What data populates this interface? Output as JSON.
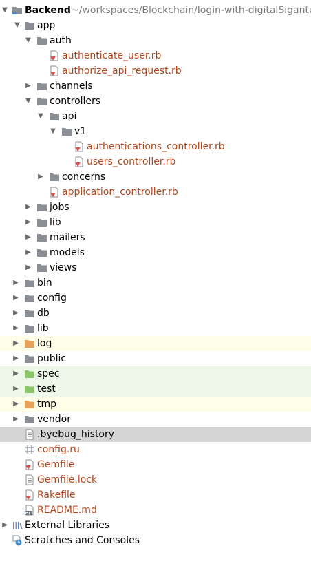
{
  "project": {
    "name": "Backend",
    "path": "~/workspaces/Blockchain/login-with-digitalSiganture"
  },
  "tree": {
    "app": "app",
    "auth": "auth",
    "authenticate_user": "authenticate_user.rb",
    "authorize_api_request": "authorize_api_request.rb",
    "channels": "channels",
    "controllers": "controllers",
    "api": "api",
    "v1": "v1",
    "authentications_controller": "authentications_controller.rb",
    "users_controller": "users_controller.rb",
    "concerns": "concerns",
    "application_controller": "application_controller.rb",
    "jobs": "jobs",
    "app_lib": "lib",
    "mailers": "mailers",
    "models": "models",
    "views": "views",
    "bin": "bin",
    "config": "config",
    "db": "db",
    "lib": "lib",
    "log": "log",
    "public": "public",
    "spec": "spec",
    "test": "test",
    "tmp": "tmp",
    "vendor": "vendor",
    "byebug_history": ".byebug_history",
    "config_ru": "config.ru",
    "gemfile": "Gemfile",
    "gemfile_lock": "Gemfile.lock",
    "rakefile": "Rakefile",
    "readme": "README.md",
    "external_libraries": "External Libraries",
    "scratches": "Scratches and Consoles"
  },
  "colors": {
    "folder": "#8a8f96",
    "folder_excluded": "#e8a25a",
    "folder_test": "#8bc56a",
    "ruby_file_text": "#b0461a",
    "ruby_icon": "#d9534f",
    "excluded_row_bg": "#fdfde8",
    "test_row_bg": "#eef8e8",
    "selected_row_bg": "#d5d5d5"
  },
  "icons": {
    "folder": "folder-icon",
    "module": "module-folder-icon",
    "ruby": "ruby-file-icon",
    "text": "text-file-icon",
    "config": "config-file-icon",
    "markdown": "markdown-file-icon",
    "libraries": "libraries-icon",
    "scratches": "scratches-icon"
  }
}
